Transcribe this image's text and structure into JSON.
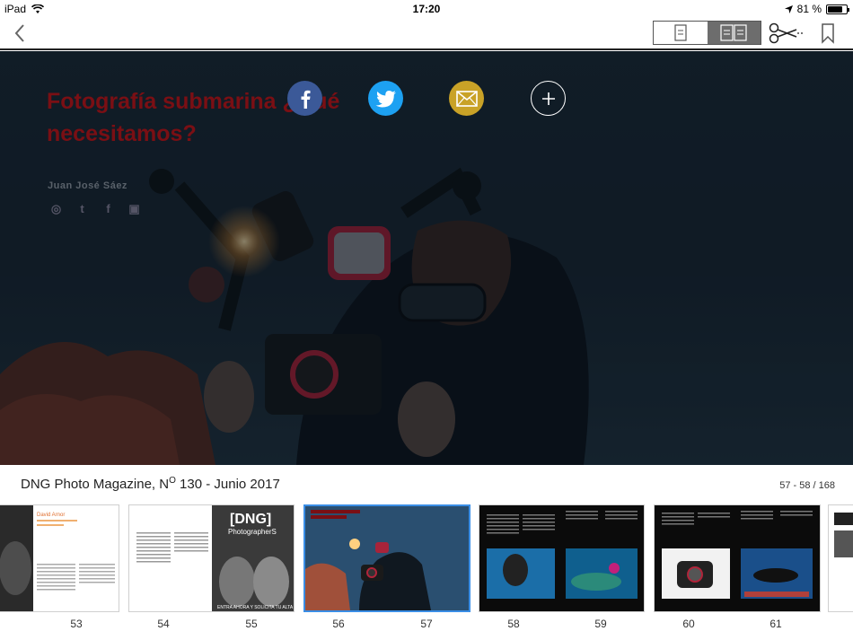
{
  "status_bar": {
    "device": "iPad",
    "time": "17:20",
    "battery": "81 %",
    "battery_level": 0.81
  },
  "toolbar": {
    "back_icon": "chevron-left-icon",
    "single_page_icon": "single-page-icon",
    "double_page_icon": "double-page-icon",
    "clip_icon": "scissors-icon",
    "bookmark_icon": "bookmark-icon"
  },
  "article": {
    "title": "Fotografía submarina ¿Qué necesitamos?",
    "author": "Juan José Sáez",
    "author_icons": [
      "web-icon",
      "twitter-icon",
      "facebook-icon",
      "instagram-icon"
    ]
  },
  "share": {
    "facebook_icon": "facebook-icon",
    "twitter_icon": "twitter-icon",
    "mail_icon": "mail-icon",
    "more_icon": "plus-icon"
  },
  "magazine": {
    "title_prefix": "DNG Photo Magazine, N",
    "title_sup": "O",
    "title_suffix": " 130 - Junio 2017",
    "page_range": "57 - 58 / 168"
  },
  "thumbnails": {
    "pages": [
      "53",
      "54",
      "55",
      "56",
      "57",
      "58",
      "59",
      "60",
      "61"
    ],
    "thumb_texts": {
      "t1_name": "David Arnor",
      "t2_logo": "[DNG]",
      "t2_sub": "PhotographerS",
      "t2_footer": "ENTRA AHORA Y SOLICITA TU ALTA"
    }
  },
  "colors": {
    "accent": "#3a8ee6",
    "facebook": "#3b5998",
    "twitter": "#1da1f2",
    "mail": "#c9a227",
    "title_red": "#7a0f14"
  }
}
